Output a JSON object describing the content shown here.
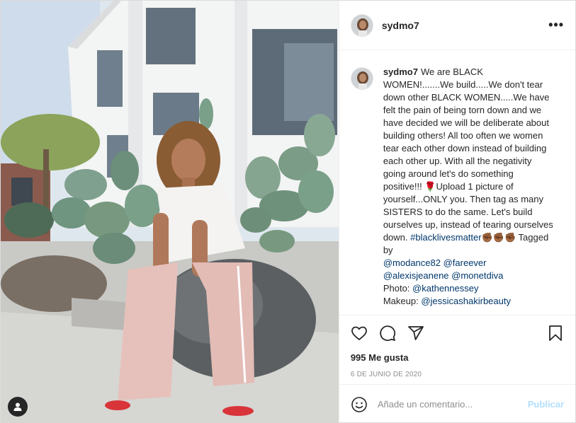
{
  "post": {
    "username": "sydmo7",
    "caption": {
      "text_1": "We are BLACK WOMEN!.......We build.....We don't tear down other BLACK WOMEN.....We have felt the pain of being torn down and we have decided we will be deliberate about building others! All too often we women tear each other down instead of building each other up. With all the negativity going around let's do something positive!!! 🌹Upload 1 picture of yourself...ONLY you. Then tag as many SISTERS to do the same. Let's build ourselves up, instead of tearing ourselves down.",
      "hashtag": "#blacklivesmatter",
      "fists": "✊🏾✊🏾✊🏾",
      "tagged_by": "Tagged by",
      "mention_1": "@modance82",
      "mention_2": "@fareever",
      "mention_3": "@alexisjeanene",
      "mention_4": "@monetdiva",
      "photo_label": "Photo:",
      "photo_mention": "@kathennessey",
      "makeup_label": "Makeup:",
      "makeup_mention": "@jessicashakirbeauty"
    },
    "likes": "995 Me gusta",
    "date": "6 DE JUNIO DE 2020",
    "comment_placeholder": "Añade un comentario...",
    "publish_label": "Publicar",
    "more_icon": "•••"
  },
  "icons": {
    "like": "heart-icon",
    "comment": "comment-icon",
    "share": "share-icon",
    "save": "bookmark-icon",
    "emoji": "emoji-icon",
    "user_tags": "user-icon"
  },
  "colors": {
    "link": "#00376b",
    "publish_disabled": "#b2dffc",
    "muted": "#8e8e8e"
  }
}
